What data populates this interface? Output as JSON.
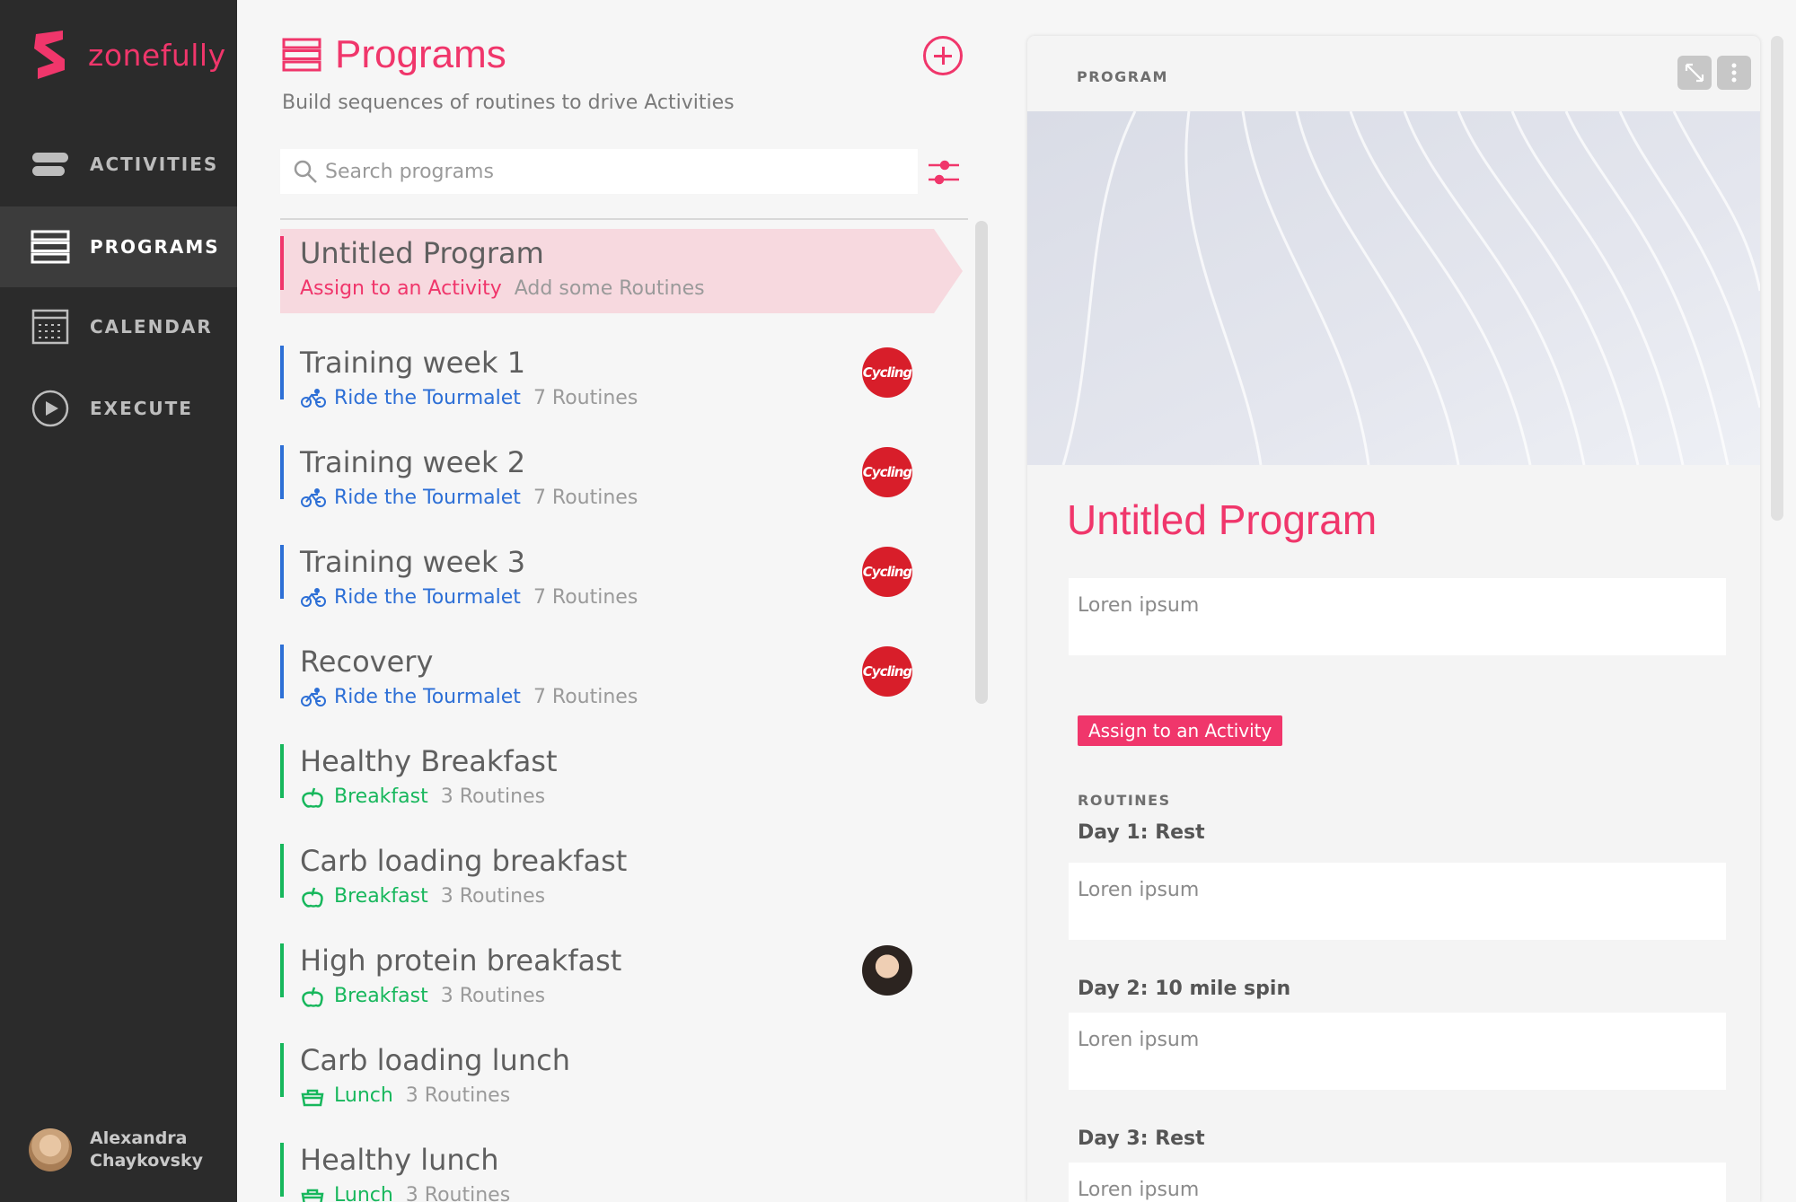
{
  "app": {
    "brand": "zonefully",
    "accent": "#f0366b"
  },
  "sidebar": {
    "items": [
      {
        "label": "ACTIVITIES",
        "icon": "activities-icon"
      },
      {
        "label": "PROGRAMS",
        "icon": "programs-icon",
        "active": true
      },
      {
        "label": "CALENDAR",
        "icon": "calendar-icon"
      },
      {
        "label": "EXECUTE",
        "icon": "play-icon"
      }
    ],
    "user": {
      "first_name": "Alexandra",
      "last_name": "Chaykovsky"
    }
  },
  "programs": {
    "title": "Programs",
    "subtitle": "Build sequences of routines to drive Activities",
    "search": {
      "placeholder": "Search programs",
      "value": ""
    },
    "list": [
      {
        "title": "Untitled Program",
        "link": "Assign to an Activity",
        "count": "Add some Routines",
        "selected": true,
        "color": "#f0366b"
      },
      {
        "title": "Training week 1",
        "link": "Ride the Tourmalet",
        "count": "7 Routines",
        "category": "bike-icon",
        "color": "#2d6fd6",
        "badge": "Cycling"
      },
      {
        "title": "Training week 2",
        "link": "Ride the Tourmalet",
        "count": "7 Routines",
        "category": "bike-icon",
        "color": "#2d6fd6",
        "badge": "Cycling"
      },
      {
        "title": "Training week 3",
        "link": "Ride the Tourmalet",
        "count": "7 Routines",
        "category": "bike-icon",
        "color": "#2d6fd6",
        "badge": "Cycling"
      },
      {
        "title": "Recovery",
        "link": "Ride the Tourmalet",
        "count": "7 Routines",
        "category": "bike-icon",
        "color": "#2d6fd6",
        "badge": "Cycling"
      },
      {
        "title": "Healthy Breakfast",
        "link": "Breakfast",
        "count": "3 Routines",
        "category": "apple-icon",
        "color": "#17b75c"
      },
      {
        "title": "Carb loading breakfast",
        "link": "Breakfast",
        "count": "3 Routines",
        "category": "apple-icon",
        "color": "#17b75c"
      },
      {
        "title": "High protein breakfast",
        "link": "Breakfast",
        "count": "3 Routines",
        "category": "apple-icon",
        "color": "#17b75c",
        "avatar": true
      },
      {
        "title": "Carb loading lunch",
        "link": "Lunch",
        "count": "3 Routines",
        "category": "lunchbox-icon",
        "color": "#17b75c"
      },
      {
        "title": "Healthy lunch",
        "link": "Lunch",
        "count": "3 Routines",
        "category": "lunchbox-icon",
        "color": "#17b75c"
      }
    ]
  },
  "detail": {
    "label": "PROGRAM",
    "title": "Untitled Program",
    "description": "Loren ipsum",
    "assign_label": "Assign to an Activity",
    "routines_label": "ROUTINES",
    "routines": [
      {
        "name": "Day 1: Rest",
        "notes": "Loren ipsum"
      },
      {
        "name": "Day 2: 10 mile spin",
        "notes": "Loren ipsum"
      },
      {
        "name": "Day 3: Rest",
        "notes": "Loren ipsum"
      }
    ]
  }
}
